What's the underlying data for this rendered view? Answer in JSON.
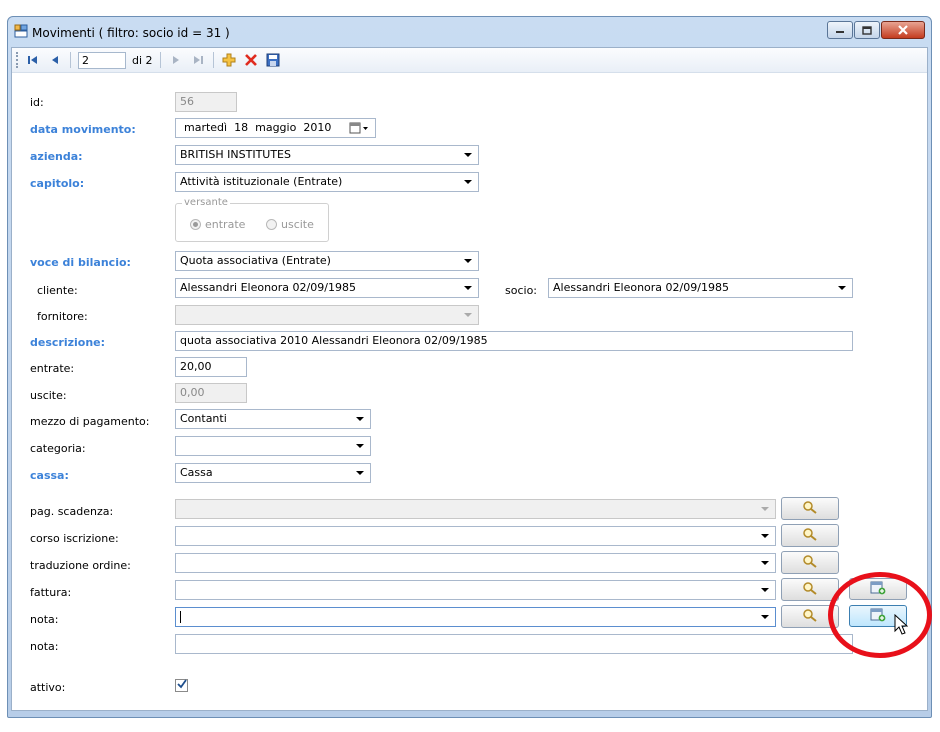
{
  "window": {
    "title": "Movimenti ( filtro: socio id = 31 )",
    "icons": {
      "app": "form-icon",
      "minimize": "minimize-icon",
      "maximize": "maximize-icon",
      "close": "close-icon"
    }
  },
  "toolbar": {
    "position": "2",
    "total": "di 2",
    "icons": [
      "first-record-icon",
      "previous-record-icon",
      "next-record-icon",
      "last-record-icon",
      "add-icon",
      "delete-icon",
      "save-icon"
    ]
  },
  "form": {
    "id": {
      "label": "id:",
      "value": "56"
    },
    "data_movimento": {
      "label": "data movimento:",
      "weekday": "martedì",
      "day": "18",
      "month": "maggio",
      "year": "2010"
    },
    "azienda": {
      "label": "azienda:",
      "value": "BRITISH INSTITUTES"
    },
    "capitolo": {
      "label": "capitolo:",
      "value": "Attività istituzionale (Entrate)"
    },
    "versante": {
      "title": "versante",
      "entrate": "entrate",
      "uscite": "uscite",
      "selected": "entrate"
    },
    "voce_di_bilancio": {
      "label": "voce di bilancio:",
      "value": "Quota associativa (Entrate)"
    },
    "cliente": {
      "label": "cliente:",
      "value": "Alessandri Eleonora 02/09/1985"
    },
    "socio": {
      "label": "socio:",
      "value": "Alessandri Eleonora 02/09/1985"
    },
    "fornitore": {
      "label": "fornitore:",
      "value": ""
    },
    "descrizione": {
      "label": "descrizione:",
      "value": "quota associativa 2010 Alessandri Eleonora 02/09/1985"
    },
    "entrate": {
      "label": "entrate:",
      "value": "20,00"
    },
    "uscite": {
      "label": "uscite:",
      "value": "0,00"
    },
    "mezzo_di_pagamento": {
      "label": "mezzo di pagamento:",
      "value": "Contanti"
    },
    "categoria": {
      "label": "categoria:",
      "value": ""
    },
    "cassa": {
      "label": "cassa:",
      "value": "Cassa"
    },
    "pag_scadenza": {
      "label": "pag. scadenza:",
      "value": ""
    },
    "corso_iscrizione": {
      "label": "corso iscrizione:",
      "value": ""
    },
    "traduzione_ordine": {
      "label": "traduzione ordine:",
      "value": ""
    },
    "fattura": {
      "label": "fattura:",
      "value": ""
    },
    "nota_select": {
      "label": "nota:",
      "value": ""
    },
    "nota_text": {
      "label": "nota:",
      "value": ""
    },
    "attivo": {
      "label": "attivo:",
      "checked": true
    }
  },
  "colors": {
    "required_label": "#3c82d9",
    "annotation_circle": "#e8101a",
    "window_frame": "#b7cde8"
  }
}
